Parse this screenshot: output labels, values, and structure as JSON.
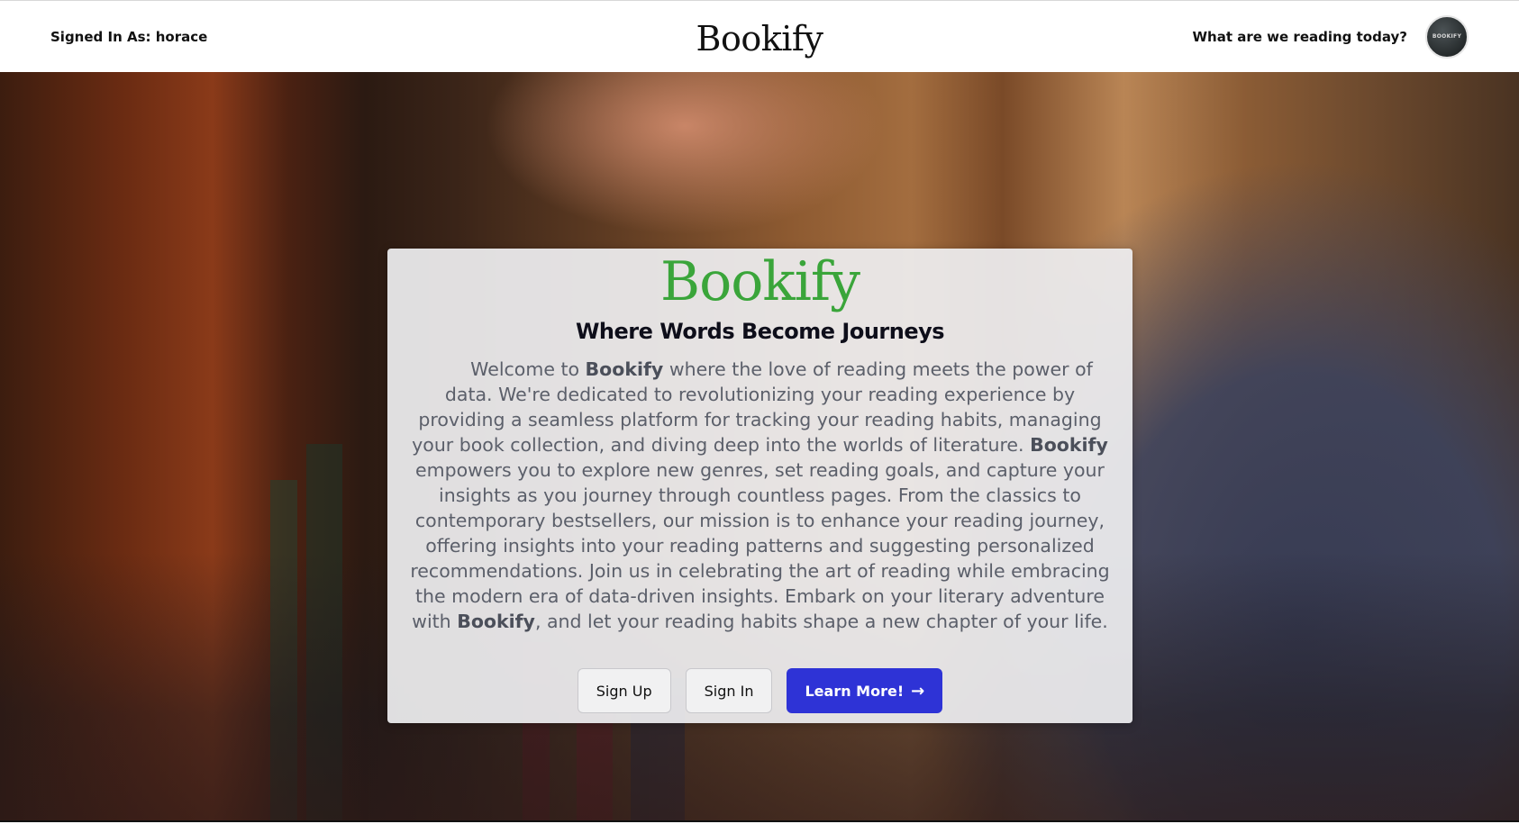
{
  "navbar": {
    "signed_in": "Signed In As: horace",
    "brand": "Bookify",
    "question": "What are we reading today?",
    "avatar_text": "BOOKIFY"
  },
  "hero": {
    "logo": "Bookify",
    "tagline": "Where Words Become Journeys",
    "body": {
      "part1": "Welcome to ",
      "brand1": "Bookify",
      "part2": " where the love of reading meets the power of data. We're dedicated to revolutionizing your reading experience by providing a seamless platform for tracking your reading habits, managing your book collection, and diving deep into the worlds of literature. ",
      "brand2": "Bookify",
      "part3": " empowers you to explore new genres, set reading goals, and capture your insights as you journey through countless pages. From the classics to contemporary bestsellers, our mission is to enhance your reading journey, offering insights into your reading patterns and suggesting personalized recommendations. Join us in celebrating the art of reading while embracing the modern era of data-driven insights. Embark on your literary adventure with ",
      "brand3": "Bookify",
      "part4": ", and let your reading habits shape a new chapter of your life."
    },
    "buttons": {
      "sign_up": "Sign Up",
      "sign_in": "Sign In",
      "learn_more": "Learn More!",
      "learn_more_arrow": "→"
    }
  },
  "colors": {
    "accent": "#2e33d6",
    "logo_green": "#3aa53a"
  }
}
